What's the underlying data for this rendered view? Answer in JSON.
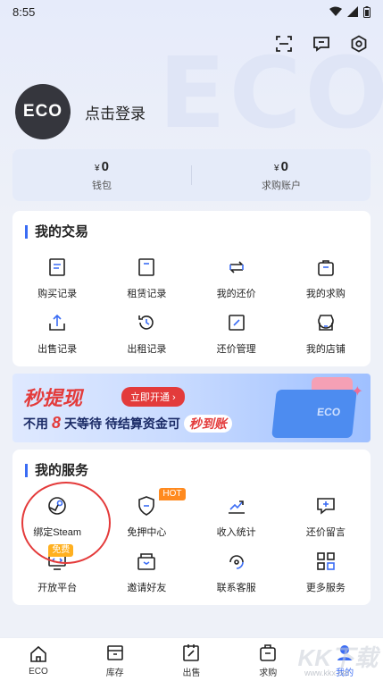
{
  "status": {
    "time": "8:55"
  },
  "header": {
    "watermark": "ECO"
  },
  "profile": {
    "avatar_text": "ECO",
    "login_label": "点击登录"
  },
  "wallet": {
    "currency": "¥",
    "items": [
      {
        "amount": "0",
        "label": "钱包"
      },
      {
        "amount": "0",
        "label": "求购账户"
      }
    ]
  },
  "trade": {
    "title": "我的交易",
    "items": [
      {
        "label": "购买记录",
        "icon": "receipt-icon"
      },
      {
        "label": "租赁记录",
        "icon": "rent-icon"
      },
      {
        "label": "我的还价",
        "icon": "swap-icon"
      },
      {
        "label": "我的求购",
        "icon": "bag-icon"
      },
      {
        "label": "出售记录",
        "icon": "upload-icon"
      },
      {
        "label": "出租记录",
        "icon": "history-icon"
      },
      {
        "label": "还价管理",
        "icon": "edit-icon"
      },
      {
        "label": "我的店铺",
        "icon": "store-icon"
      }
    ]
  },
  "banner": {
    "title": "秒提现",
    "button": "立即开通 ›",
    "sub_prefix": "不用",
    "sub_num": "8",
    "sub_mid": "天等待 待结算资金可",
    "sub_pill": "秒到账",
    "box_text": "ECO"
  },
  "services": {
    "title": "我的服务",
    "items": [
      {
        "label": "绑定Steam",
        "icon": "steam-icon",
        "badge": ""
      },
      {
        "label": "免押中心",
        "icon": "shield-icon",
        "badge": "HOT"
      },
      {
        "label": "收入统计",
        "icon": "chart-icon",
        "badge": ""
      },
      {
        "label": "还价留言",
        "icon": "message-icon",
        "badge": ""
      },
      {
        "label": "开放平台",
        "icon": "platform-icon",
        "badge": "免费"
      },
      {
        "label": "邀请好友",
        "icon": "invite-icon",
        "badge": ""
      },
      {
        "label": "联系客服",
        "icon": "support-icon",
        "badge": ""
      },
      {
        "label": "更多服务",
        "icon": "grid-icon",
        "badge": ""
      }
    ]
  },
  "tabbar": {
    "items": [
      {
        "label": "ECO",
        "icon": "home-icon"
      },
      {
        "label": "库存",
        "icon": "inventory-icon"
      },
      {
        "label": "出售",
        "icon": "sell-icon"
      },
      {
        "label": "求购",
        "icon": "buy-icon"
      },
      {
        "label": "我的",
        "icon": "profile-icon"
      }
    ],
    "active_index": 4,
    "watermark": "KK下载",
    "watermark_url": "www.kkx.net"
  },
  "colors": {
    "accent": "#3a6cf4",
    "red": "#e33b3b",
    "badge": "#ff8a1f"
  }
}
